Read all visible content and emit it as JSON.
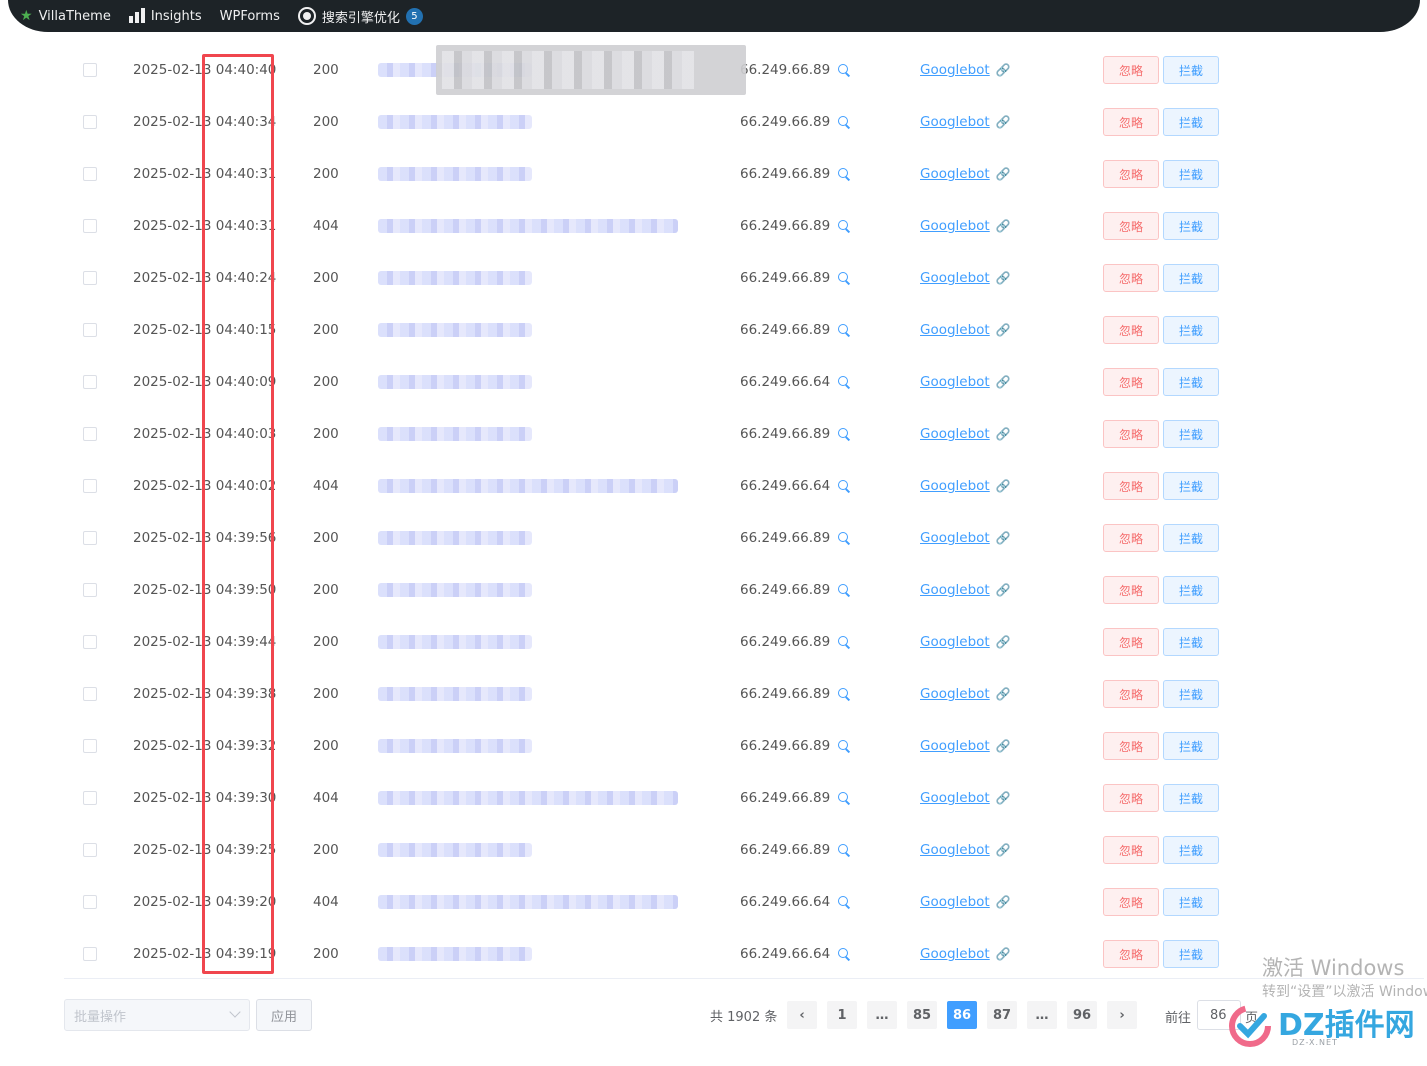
{
  "adminbar": {
    "items": [
      {
        "label": "VillaTheme",
        "icon": "star-icon"
      },
      {
        "label": "Insights",
        "icon": "bar-chart-icon"
      },
      {
        "label": "WPForms",
        "icon": ""
      },
      {
        "label": "搜索引擎优化",
        "icon": "gear-icon",
        "badge": "5"
      }
    ]
  },
  "rows": [
    {
      "time": "2025-02-13 04:40:40",
      "status": "200",
      "ip": "66.249.66.89",
      "bot": "Googlebot",
      "url_len": "short"
    },
    {
      "time": "2025-02-13 04:40:34",
      "status": "200",
      "ip": "66.249.66.89",
      "bot": "Googlebot",
      "url_len": "short"
    },
    {
      "time": "2025-02-13 04:40:31",
      "status": "200",
      "ip": "66.249.66.89",
      "bot": "Googlebot",
      "url_len": "short"
    },
    {
      "time": "2025-02-13 04:40:31",
      "status": "404",
      "ip": "66.249.66.89",
      "bot": "Googlebot",
      "url_len": "long"
    },
    {
      "time": "2025-02-13 04:40:24",
      "status": "200",
      "ip": "66.249.66.89",
      "bot": "Googlebot",
      "url_len": "short"
    },
    {
      "time": "2025-02-13 04:40:15",
      "status": "200",
      "ip": "66.249.66.89",
      "bot": "Googlebot",
      "url_len": "short"
    },
    {
      "time": "2025-02-13 04:40:09",
      "status": "200",
      "ip": "66.249.66.64",
      "bot": "Googlebot",
      "url_len": "short"
    },
    {
      "time": "2025-02-13 04:40:03",
      "status": "200",
      "ip": "66.249.66.89",
      "bot": "Googlebot",
      "url_len": "short"
    },
    {
      "time": "2025-02-13 04:40:02",
      "status": "404",
      "ip": "66.249.66.64",
      "bot": "Googlebot",
      "url_len": "long"
    },
    {
      "time": "2025-02-13 04:39:56",
      "status": "200",
      "ip": "66.249.66.89",
      "bot": "Googlebot",
      "url_len": "short"
    },
    {
      "time": "2025-02-13 04:39:50",
      "status": "200",
      "ip": "66.249.66.89",
      "bot": "Googlebot",
      "url_len": "short"
    },
    {
      "time": "2025-02-13 04:39:44",
      "status": "200",
      "ip": "66.249.66.89",
      "bot": "Googlebot",
      "url_len": "short"
    },
    {
      "time": "2025-02-13 04:39:38",
      "status": "200",
      "ip": "66.249.66.89",
      "bot": "Googlebot",
      "url_len": "short"
    },
    {
      "time": "2025-02-13 04:39:32",
      "status": "200",
      "ip": "66.249.66.89",
      "bot": "Googlebot",
      "url_len": "short"
    },
    {
      "time": "2025-02-13 04:39:30",
      "status": "404",
      "ip": "66.249.66.89",
      "bot": "Googlebot",
      "url_len": "long"
    },
    {
      "time": "2025-02-13 04:39:25",
      "status": "200",
      "ip": "66.249.66.89",
      "bot": "Googlebot",
      "url_len": "short"
    },
    {
      "time": "2025-02-13 04:39:20",
      "status": "404",
      "ip": "66.249.66.64",
      "bot": "Googlebot",
      "url_len": "long"
    },
    {
      "time": "2025-02-13 04:39:19",
      "status": "200",
      "ip": "66.249.66.64",
      "bot": "Googlebot",
      "url_len": "short"
    }
  ],
  "actions": {
    "ignore": "忽略",
    "block": "拦截"
  },
  "footer": {
    "bulk_placeholder": "批量操作",
    "apply": "应用",
    "total": "共 1902 条",
    "pages": [
      "1",
      "…",
      "85",
      "86",
      "87",
      "…",
      "96"
    ],
    "current_page": "86",
    "goto_label": "前往",
    "goto_value": "86",
    "page_suffix": "页"
  },
  "watermark": {
    "windows_title": "激活 Windows",
    "windows_sub": "转到“设置”以激活 Windows。",
    "dz_text": "DZ插件网",
    "dz_sub": "DZ-X.NET"
  },
  "colors": {
    "primary": "#409eff",
    "danger": "#f56c6c",
    "highlight": "#f0464e",
    "adminbar": "#1d2327"
  }
}
